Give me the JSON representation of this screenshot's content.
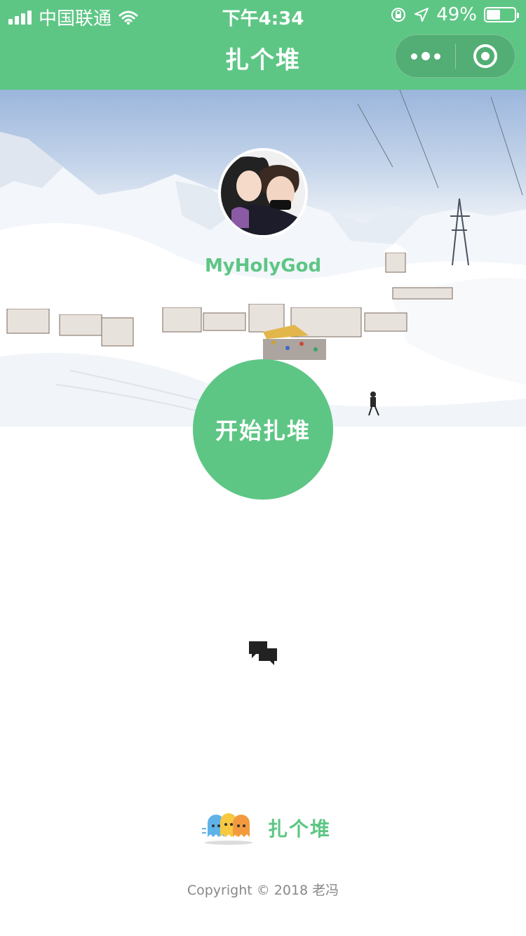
{
  "status_bar": {
    "carrier": "中国联通",
    "time": "下午4:34",
    "battery_percent": "49%",
    "battery_level": 0.49
  },
  "nav": {
    "title": "扎个堆"
  },
  "profile": {
    "username": "MyHolyGod"
  },
  "actions": {
    "start_label": "开始扎堆"
  },
  "footer": {
    "brand": "扎个堆",
    "copyright": "Copyright © 2018 老冯"
  },
  "colors": {
    "primary": "#5ec685",
    "text_muted": "#888888"
  },
  "icons": [
    "signal-icon",
    "wifi-icon",
    "lock-rotation-icon",
    "location-icon",
    "battery-icon",
    "more-icon",
    "close-mini-program-icon",
    "chat-icon",
    "ghost-logo-icon"
  ]
}
